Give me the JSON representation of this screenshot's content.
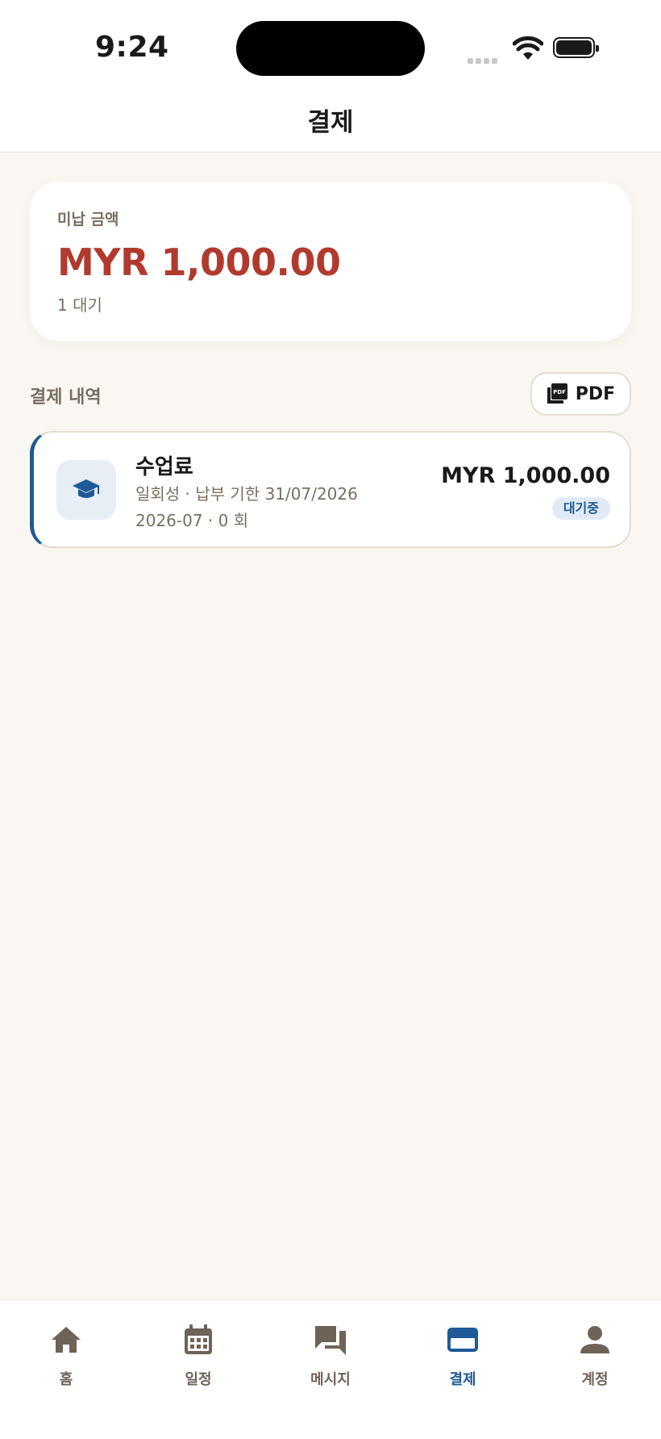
{
  "status_bar": {
    "time": "9:24"
  },
  "header": {
    "title": "결제"
  },
  "summary": {
    "label": "미납 금액",
    "amount": "MYR 1,000.00",
    "pending_count": "1 대기"
  },
  "history": {
    "section_title": "결제 내역",
    "pdf_label": "PDF",
    "items": [
      {
        "icon": "graduation-cap-icon",
        "title": "수업료",
        "meta_line1": "일회성 · 납부 기한 31/07/2026",
        "meta_line2": "2026-07 · 0 회",
        "amount": "MYR 1,000.00",
        "status": "대기중"
      }
    ]
  },
  "tabs": [
    {
      "label": "홈",
      "icon": "home-icon"
    },
    {
      "label": "일정",
      "icon": "calendar-icon"
    },
    {
      "label": "메시지",
      "icon": "chat-icon"
    },
    {
      "label": "결제",
      "icon": "credit-card-icon",
      "active": true
    },
    {
      "label": "계정",
      "icon": "person-icon"
    }
  ],
  "colors": {
    "accent": "#1f5a96",
    "amount_due": "#b03a2e",
    "background": "#faf7f2",
    "muted_text": "#7a6e62"
  }
}
